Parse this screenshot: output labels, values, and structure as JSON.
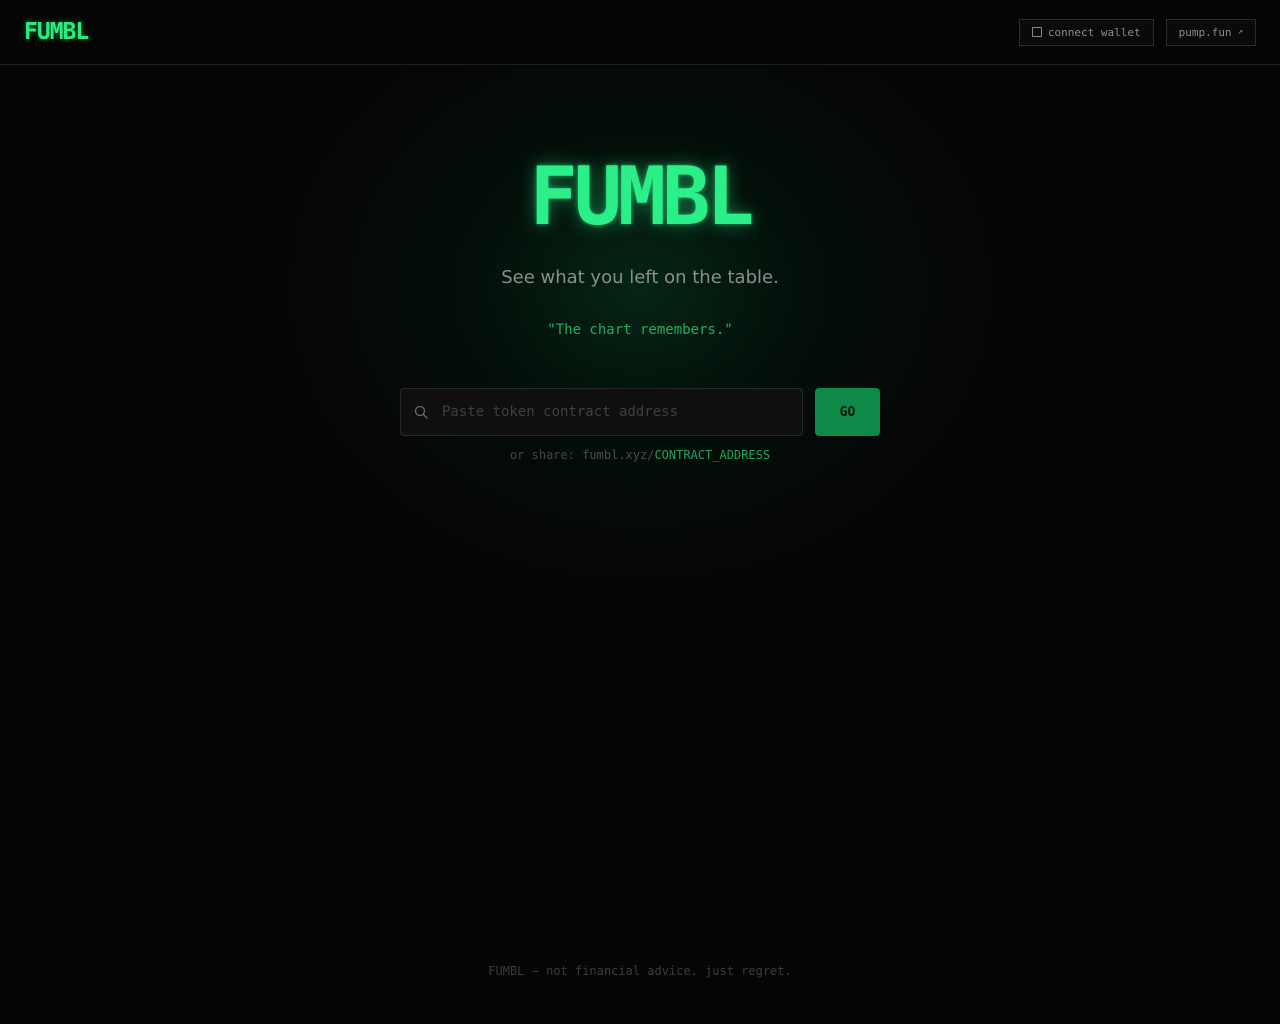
{
  "header": {
    "logo": "FUMBL",
    "connect_wallet_label": "connect wallet",
    "pump_label": "pump.fun",
    "pump_arrow": "↗"
  },
  "hero": {
    "title": "FUMBL",
    "tagline": "See what you left on the table.",
    "quote": "\"The chart remembers.\""
  },
  "search": {
    "placeholder": "Paste token contract address",
    "value": "",
    "go_label": "GO"
  },
  "share": {
    "prefix": "or share: ",
    "domain": "fumbl.xyz/",
    "address": "CONTRACT_ADDRESS"
  },
  "footer": {
    "text": "FUMBL — not financial advice. just regret."
  },
  "colors": {
    "accent": "#2bf08a",
    "button": "#0d8a48",
    "background": "#050505"
  },
  "icons": {
    "wallet": "wallet-icon",
    "search": "search-icon",
    "external": "external-link-icon"
  }
}
